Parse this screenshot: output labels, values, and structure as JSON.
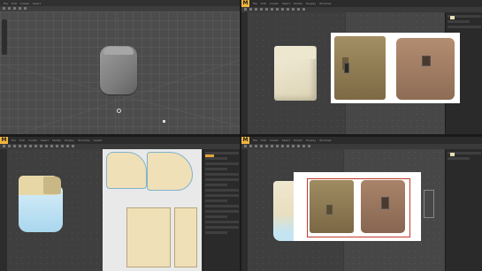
{
  "app_logo": "M",
  "menu": [
    "File",
    "Edit",
    "Create",
    "Select",
    "Modify",
    "Display",
    "Windows",
    "Assets",
    "Animation",
    "Simulation",
    "Settings",
    "Help"
  ],
  "quadrants": {
    "top_left": {
      "name": "blender-viewport"
    },
    "top_right": {
      "name": "marvelous-reference-view"
    },
    "bottom_left": {
      "name": "marvelous-3d-and-2d-pattern-view"
    },
    "bottom_right": {
      "name": "marvelous-reference-overlay-view"
    }
  },
  "colors": {
    "pattern_fill": "#efe0b8",
    "sim_blue": "#b9dff2",
    "pouch_coyote": "#8e7a52",
    "pouch_tan": "#a27d61",
    "logo_accent": "#f0b43c"
  }
}
